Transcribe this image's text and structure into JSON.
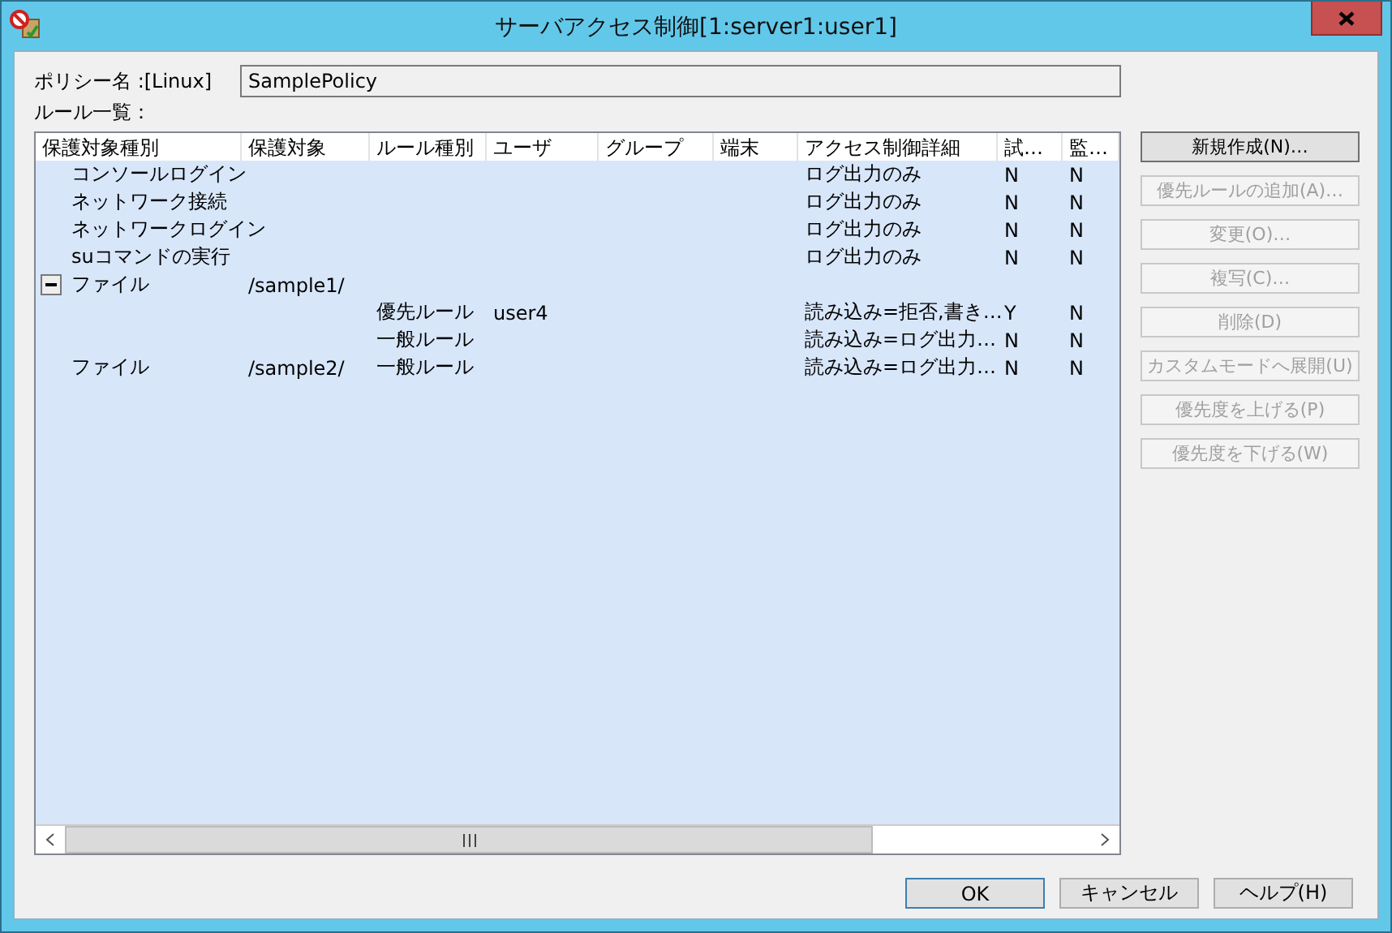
{
  "window": {
    "title": "サーバアクセス制御[1:server1:user1]"
  },
  "policy": {
    "label": "ポリシー名 :[Linux]",
    "value": "SamplePolicy"
  },
  "list_label": "ルール一覧：",
  "table": {
    "columns": [
      "保護対象種別",
      "保護対象",
      "ルール種別",
      "ユーザ",
      "グループ",
      "端末",
      "アクセス制御詳細",
      "試…",
      "監…"
    ],
    "rows": [
      {
        "type": "コンソールログイン",
        "detail": "ログ出力のみ",
        "col_8": "N",
        "col_9": "N"
      },
      {
        "type": "ネットワーク接続",
        "detail": "ログ出力のみ",
        "col_8": "N",
        "col_9": "N"
      },
      {
        "type": "ネットワークログイン",
        "detail": "ログ出力のみ",
        "col_8": "N",
        "col_9": "N"
      },
      {
        "type": "suコマンドの実行",
        "detail": "ログ出力のみ",
        "col_8": "N",
        "col_9": "N"
      },
      {
        "type": "ファイル",
        "target": "/sample1/",
        "expanded": true,
        "children": [
          {
            "rule_type": "優先ルール",
            "user": "user4",
            "detail": "読み込み=拒否,書き…",
            "col_8": "Y",
            "col_9": "N"
          },
          {
            "rule_type": "一般ルール",
            "detail": "読み込み=ログ出力…",
            "col_8": "N",
            "col_9": "N"
          }
        ]
      },
      {
        "type": "ファイル",
        "target": "/sample2/",
        "rule_type": "一般ルール",
        "detail": "読み込み=ログ出力…",
        "col_8": "N",
        "col_9": "N"
      }
    ]
  },
  "side_buttons": [
    {
      "label": "新規作成(N)…",
      "disabled": false
    },
    {
      "label": "優先ルールの追加(A)…",
      "disabled": true
    },
    {
      "label": "変更(O)…",
      "disabled": true
    },
    {
      "label": "複写(C)…",
      "disabled": true
    },
    {
      "label": "削除(D)",
      "disabled": true
    },
    {
      "label": "カスタムモードへ展開(U)",
      "disabled": true
    },
    {
      "label": "優先度を上げる(P)",
      "disabled": true
    },
    {
      "label": "優先度を下げる(W)",
      "disabled": true
    }
  ],
  "dialog_buttons": [
    {
      "label": "OK",
      "default": true
    },
    {
      "label": "キャンセル",
      "default": false
    },
    {
      "label": "ヘルプ(H)",
      "default": false
    }
  ]
}
